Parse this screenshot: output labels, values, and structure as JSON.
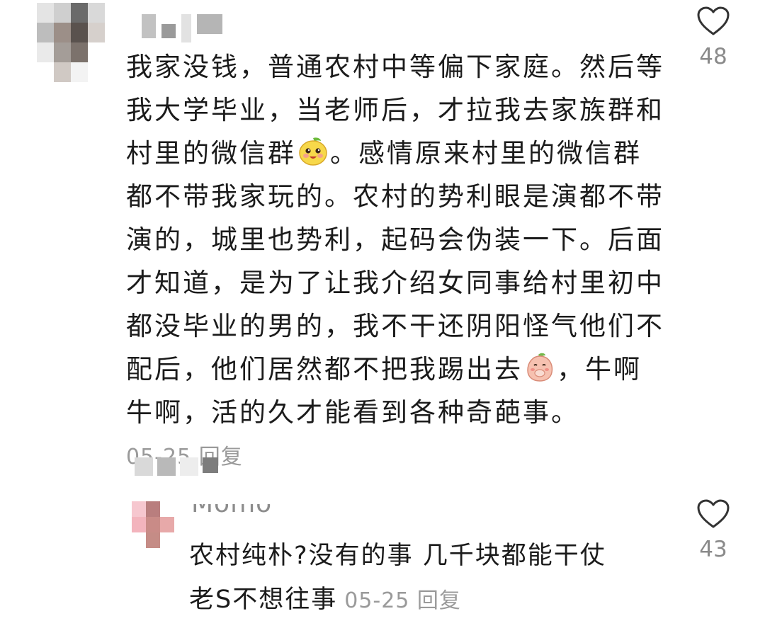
{
  "comment1": {
    "text_lines": [
      "我家没钱，普通农村中等偏下家庭。然后等",
      "我大学毕业，当老师后，才拉我去家族群和",
      "村里的微信群",
      "。感情原来村里的微信群",
      "都不带我家玩的。农村的势利眼是演都不带",
      "演的，城里也势利，起码会伪装一下。后面",
      "才知道，是为了让我介绍女同事给村里初中",
      "都没毕业的男的，我不干还阴阳怪气他们不",
      "配后，他们居然都不把我踢出去",
      "，牛啊",
      "牛啊，活的久才能看到各种奇葩事。"
    ],
    "meta": "05-25 回复",
    "likes": "48",
    "emoji_1": "mango-grin-emoji",
    "emoji_2": "peach-cover-mouth-emoji"
  },
  "comment2": {
    "username": "Momo",
    "text_line1": "农村纯朴?没有的事  几千块都能干仗",
    "text_line2": "老S不想往事",
    "meta": "05-25 回复",
    "likes": "43"
  },
  "colors": {
    "text": "#1b1b1b",
    "meta": "#9a9a9a",
    "heart_outline": "#333333"
  }
}
